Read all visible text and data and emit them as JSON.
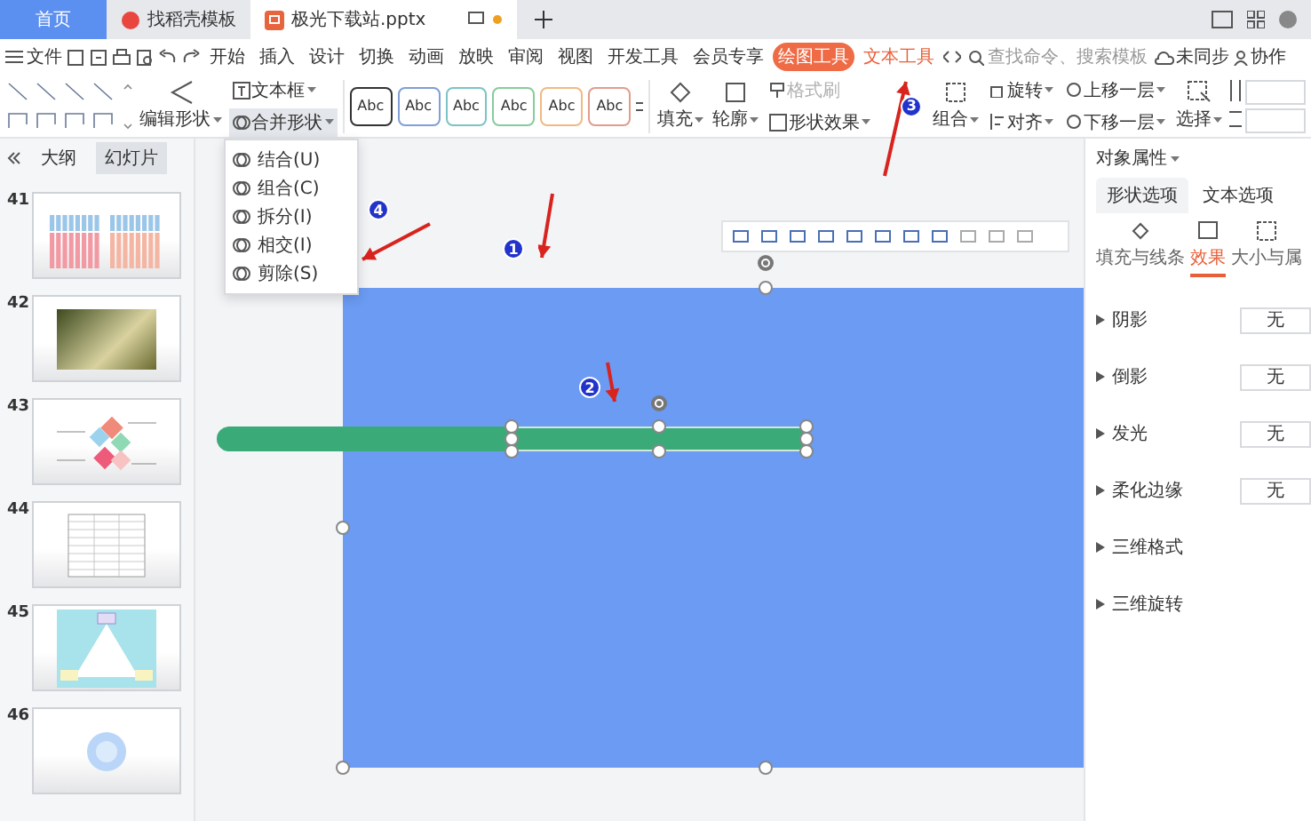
{
  "tabs": [
    {
      "label": "首页",
      "selected": false,
      "kind": "home"
    },
    {
      "label": "找稻壳模板",
      "selected": false,
      "kind": "template"
    },
    {
      "label": "极光下载站.pptx",
      "selected": true,
      "kind": "doc"
    }
  ],
  "menu": {
    "file": "文件",
    "items": [
      {
        "label": "开始",
        "selected": false,
        "contextual": false
      },
      {
        "label": "插入",
        "selected": false,
        "contextual": false
      },
      {
        "label": "设计",
        "selected": false,
        "contextual": false
      },
      {
        "label": "切换",
        "selected": false,
        "contextual": false
      },
      {
        "label": "动画",
        "selected": false,
        "contextual": false
      },
      {
        "label": "放映",
        "selected": false,
        "contextual": false
      },
      {
        "label": "审阅",
        "selected": false,
        "contextual": false
      },
      {
        "label": "视图",
        "selected": false,
        "contextual": false
      },
      {
        "label": "开发工具",
        "selected": false,
        "contextual": false
      },
      {
        "label": "会员专享",
        "selected": false,
        "contextual": false
      },
      {
        "label": "绘图工具",
        "selected": true,
        "contextual": true
      },
      {
        "label": "文本工具",
        "selected": false,
        "contextual": true
      }
    ],
    "search": {
      "placeholder": "查找命令、搜索模板"
    },
    "sync": "未同步",
    "collab": "协作"
  },
  "ribbon": {
    "edit_shape": "编辑形状",
    "text_box": "文本框",
    "merge_shape": {
      "label": "合并形状",
      "expanded": true
    },
    "styles": [
      {
        "label": "Abc",
        "color": "#333333"
      },
      {
        "label": "Abc",
        "color": "#7f9fd6"
      },
      {
        "label": "Abc",
        "color": "#7cc3c6"
      },
      {
        "label": "Abc",
        "color": "#86cc9c"
      },
      {
        "label": "Abc",
        "color": "#f1b982"
      },
      {
        "label": "Abc",
        "color": "#e29c8c"
      }
    ],
    "fill": "填充",
    "outline": "轮廓",
    "format_painter": {
      "label": "格式刷",
      "disabled": true
    },
    "shape_effect": "形状效果",
    "group": "组合",
    "rotate": "旋转",
    "align": "对齐",
    "bring_forward": "上移一层",
    "send_backward": "下移一层",
    "select": "选择"
  },
  "merge_menu": [
    {
      "label": "结合(U)"
    },
    {
      "label": "组合(C)"
    },
    {
      "label": "拆分(I)"
    },
    {
      "label": "相交(I)"
    },
    {
      "label": "剪除(S)"
    }
  ],
  "left_panel": {
    "tabs": [
      {
        "label": "大纲",
        "selected": false
      },
      {
        "label": "幻灯片",
        "selected": true
      }
    ],
    "slides": [
      {
        "number": "41",
        "kind": "bars"
      },
      {
        "number": "42",
        "kind": "photo"
      },
      {
        "number": "43",
        "kind": "diagram"
      },
      {
        "number": "44",
        "kind": "table"
      },
      {
        "number": "45",
        "kind": "triangle"
      },
      {
        "number": "46",
        "kind": "circle"
      }
    ]
  },
  "right_panel": {
    "title": "对象属性",
    "tabs": [
      {
        "label": "形状选项",
        "selected": true
      },
      {
        "label": "文本选项",
        "selected": false
      }
    ],
    "subtabs": [
      {
        "label": "填充与线条",
        "selected": false,
        "kind": "fill"
      },
      {
        "label": "效果",
        "selected": true,
        "kind": "effect"
      },
      {
        "label": "大小与属",
        "selected": false,
        "kind": "size"
      }
    ],
    "properties": [
      {
        "label": "阴影",
        "value": "无"
      },
      {
        "label": "倒影",
        "value": "无"
      },
      {
        "label": "发光",
        "value": "无"
      },
      {
        "label": "柔化边缘",
        "value": "无"
      },
      {
        "label": "三维格式"
      },
      {
        "label": "三维旋转"
      }
    ]
  },
  "annotations": [
    {
      "label": "1"
    },
    {
      "label": "2"
    },
    {
      "label": "3"
    },
    {
      "label": "4"
    }
  ]
}
